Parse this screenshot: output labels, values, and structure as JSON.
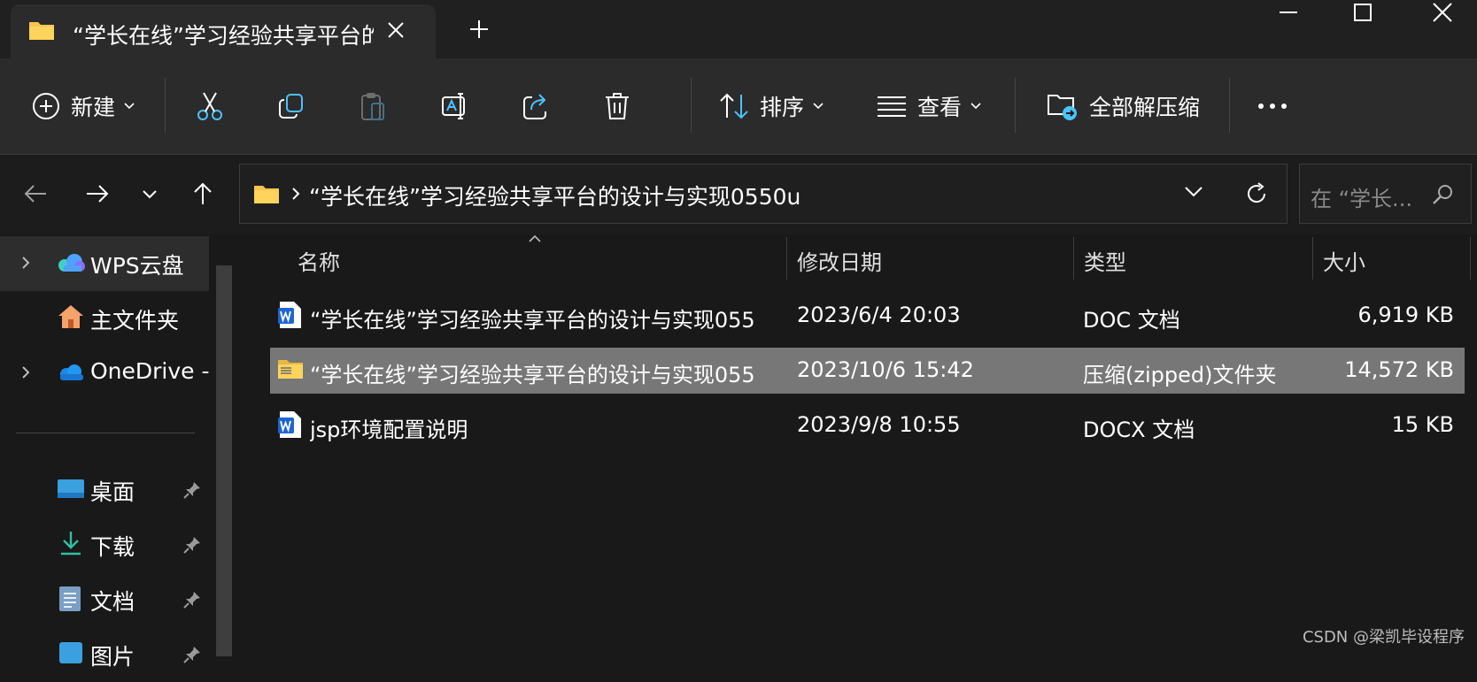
{
  "tab": {
    "title": "“学长在线”学习经验共享平台的"
  },
  "toolbar": {
    "new_label": "新建",
    "sort_label": "排序",
    "view_label": "查看",
    "extract_all_label": "全部解压缩",
    "icons": [
      "cut-icon",
      "copy-icon",
      "paste-icon",
      "rename-icon",
      "share-icon",
      "delete-icon",
      "more-icon"
    ]
  },
  "address": {
    "path": "“学长在线”学习经验共享平台的设计与实现0550u",
    "search_placeholder": "在 “学长..."
  },
  "sidebar": {
    "items": [
      {
        "label": "WPS云盘"
      },
      {
        "label": "主文件夹"
      },
      {
        "label": "OneDrive -"
      },
      {
        "label": "桌面"
      },
      {
        "label": "下载"
      },
      {
        "label": "文档"
      },
      {
        "label": "图片"
      }
    ]
  },
  "columns": {
    "name": "名称",
    "date": "修改日期",
    "type": "类型",
    "size": "大小"
  },
  "files": [
    {
      "name": "“学长在线”学习经验共享平台的设计与实现055...",
      "date": "2023/6/4 20:03",
      "type": "DOC 文档",
      "size": "6,919 KB"
    },
    {
      "name": "“学长在线”学习经验共享平台的设计与实现055...",
      "date": "2023/10/6 15:42",
      "type": "压缩(zipped)文件夹",
      "size": "14,572 KB"
    },
    {
      "name": "jsp环境配置说明",
      "date": "2023/9/8 10:55",
      "type": "DOCX 文档",
      "size": "15 KB"
    }
  ],
  "watermark": "CSDN @梁凯毕设程序",
  "colors": {
    "accent": "#4cc2ff",
    "folder": "#f8c44f",
    "selected_row": "#777777"
  }
}
